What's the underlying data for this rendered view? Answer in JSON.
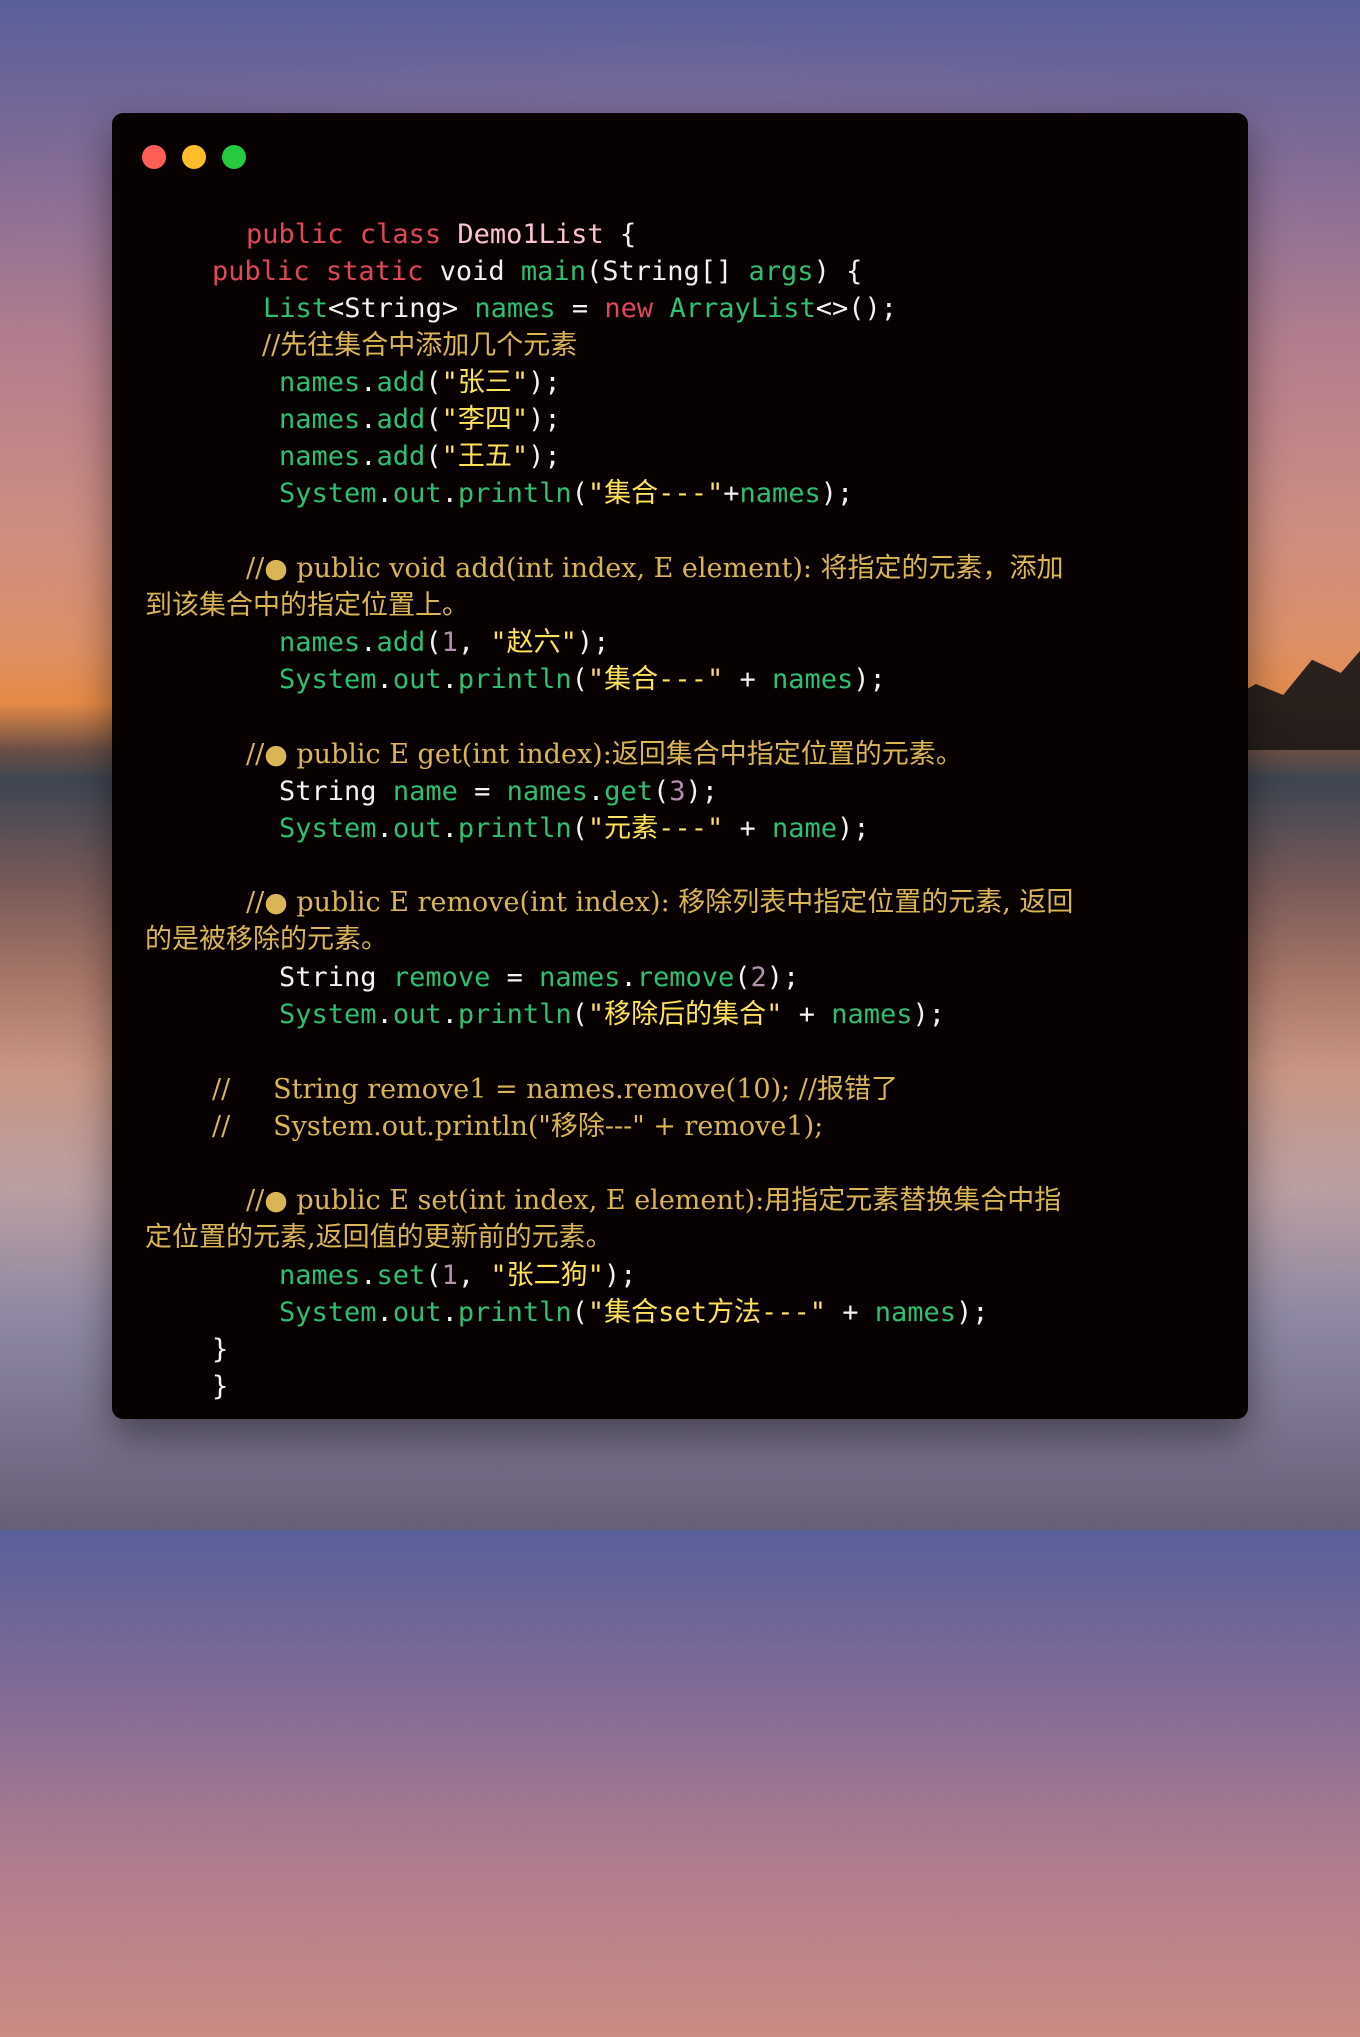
{
  "window": {
    "controls": [
      "close",
      "minimize",
      "zoom"
    ]
  },
  "code": {
    "l1": {
      "kw1": "public",
      "kw2": "class",
      "cls": "Demo1List",
      "brace": "{"
    },
    "l2": {
      "kw1": "public",
      "kw2": "static",
      "ty": "void",
      "fn": "main",
      "p1": "(",
      "arg_ty": "String[]",
      "arg": "args",
      "p2": ") {"
    },
    "l3": {
      "t1": "List",
      "t2": "<String>",
      "v": "names",
      "eq": "=",
      "kw": "new",
      "t3": "ArrayList",
      "tail": "<>();"
    },
    "l4": {
      "comment": "//先往集合中添加几个元素"
    },
    "l5": {
      "a": "names",
      "dot": ".",
      "m": "add",
      "p1": "(",
      "s": "\"张三\"",
      "p2": ");"
    },
    "l6": {
      "a": "names",
      "dot": ".",
      "m": "add",
      "p1": "(",
      "s": "\"李四\"",
      "p2": ");"
    },
    "l7": {
      "a": "names",
      "dot": ".",
      "m": "add",
      "p1": "(",
      "s": "\"王五\"",
      "p2": ");"
    },
    "l8": {
      "a": "System",
      "d1": ".",
      "b": "out",
      "d2": ".",
      "m": "println",
      "p1": "(",
      "s": "\"集合---\"",
      "plus": "+",
      "v": "names",
      "p2": ");"
    },
    "c1a": {
      "text": "//● public void add(int index, E element): 将指定的元素，添加"
    },
    "c1b": {
      "text": "到该集合中的指定位置上。"
    },
    "l9": {
      "a": "names",
      "dot": ".",
      "m": "add",
      "p1": "(",
      "n": "1",
      "comma": ",",
      "s": "\"赵六\"",
      "p2": ");"
    },
    "l10": {
      "a": "System",
      "d1": ".",
      "b": "out",
      "d2": ".",
      "m": "println",
      "p1": "(",
      "s": "\"集合---\"",
      "plus": "+",
      "v": "names",
      "p2": ");"
    },
    "c2": {
      "text": "//● public E get(int index):返回集合中指定位置的元素。"
    },
    "l11": {
      "ty": "String",
      "v": "name",
      "eq": "=",
      "a": "names",
      "dot": ".",
      "m": "get",
      "p1": "(",
      "n": "3",
      "p2": ");"
    },
    "l12": {
      "a": "System",
      "d1": ".",
      "b": "out",
      "d2": ".",
      "m": "println",
      "p1": "(",
      "s": "\"元素---\"",
      "plus": "+",
      "v": "name",
      "p2": ");"
    },
    "c3a": {
      "text": "//● public E remove(int index): 移除列表中指定位置的元素, 返回"
    },
    "c3b": {
      "text": "的是被移除的元素。"
    },
    "l13": {
      "ty": "String",
      "v": "remove",
      "eq": "=",
      "a": "names",
      "dot": ".",
      "m": "remove",
      "p1": "(",
      "n": "2",
      "p2": ");"
    },
    "l14": {
      "a": "System",
      "d1": ".",
      "b": "out",
      "d2": ".",
      "m": "println",
      "p1": "(",
      "s": "\"移除后的集合\"",
      "plus": "+",
      "v": "names",
      "p2": ");"
    },
    "c4": {
      "text": "//     String remove1 = names.remove(10); //报错了"
    },
    "c5": {
      "text": "//     System.out.println(\"移除---\" + remove1);"
    },
    "c6a": {
      "text": "//● public E set(int index, E element):用指定元素替换集合中指"
    },
    "c6b": {
      "text": "定位置的元素,返回值的更新前的元素。"
    },
    "l15": {
      "a": "names",
      "dot": ".",
      "m": "set",
      "p1": "(",
      "n": "1",
      "comma": ",",
      "s": "\"张二狗\"",
      "p2": ");"
    },
    "l16": {
      "a": "System",
      "d1": ".",
      "b": "out",
      "d2": ".",
      "m": "println",
      "p1": "(",
      "s": "\"集合set方法---\"",
      "plus": "+",
      "v": "names",
      "p2": ");"
    },
    "close1": "}",
    "close2": "}"
  }
}
